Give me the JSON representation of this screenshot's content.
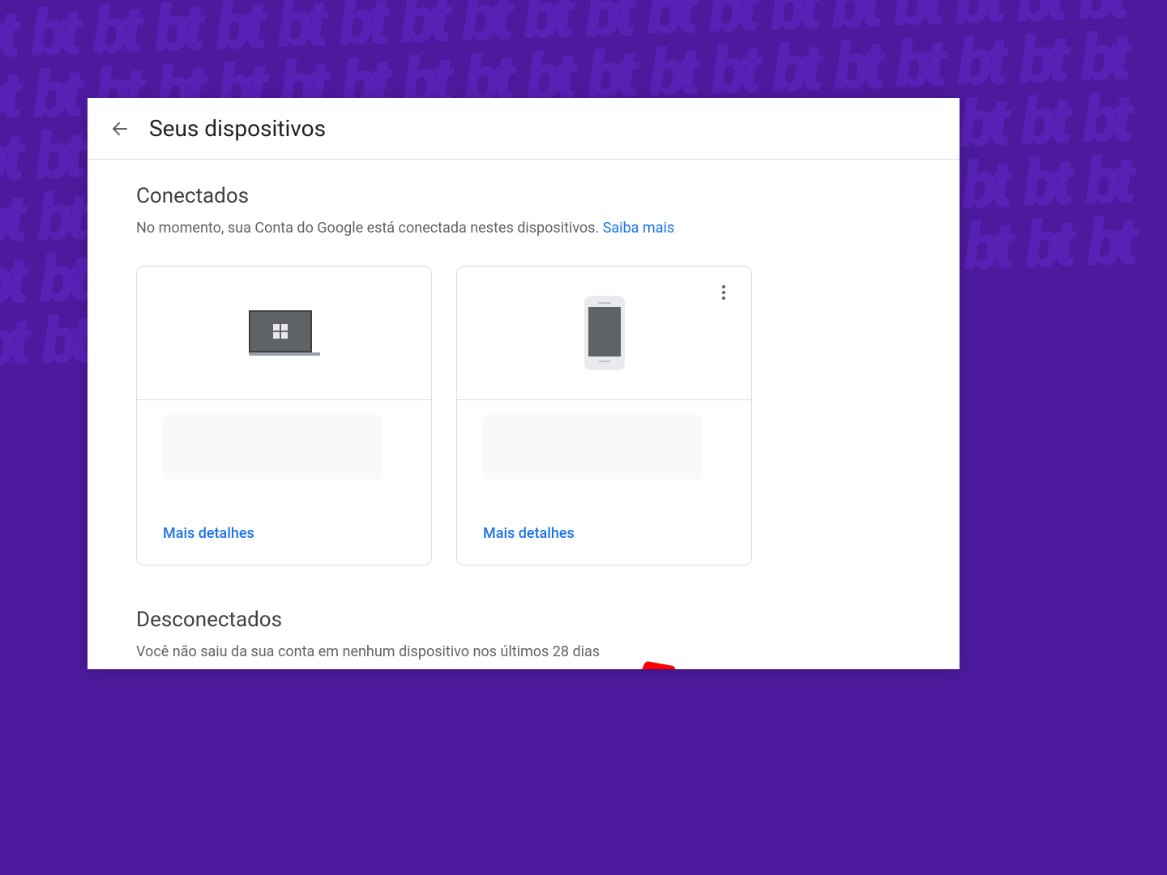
{
  "header": {
    "title": "Seus dispositivos"
  },
  "connected": {
    "title": "Conectados",
    "description": "No momento, sua Conta do Google está conectada nestes dispositivos. ",
    "learn_more": "Saiba mais",
    "cards": [
      {
        "more_label": "Mais detalhes"
      },
      {
        "more_label": "Mais detalhes"
      }
    ]
  },
  "disconnected": {
    "title": "Desconectados",
    "description": "Você não saiu da sua conta em nenhum dispositivo nos últimos 28 dias"
  }
}
